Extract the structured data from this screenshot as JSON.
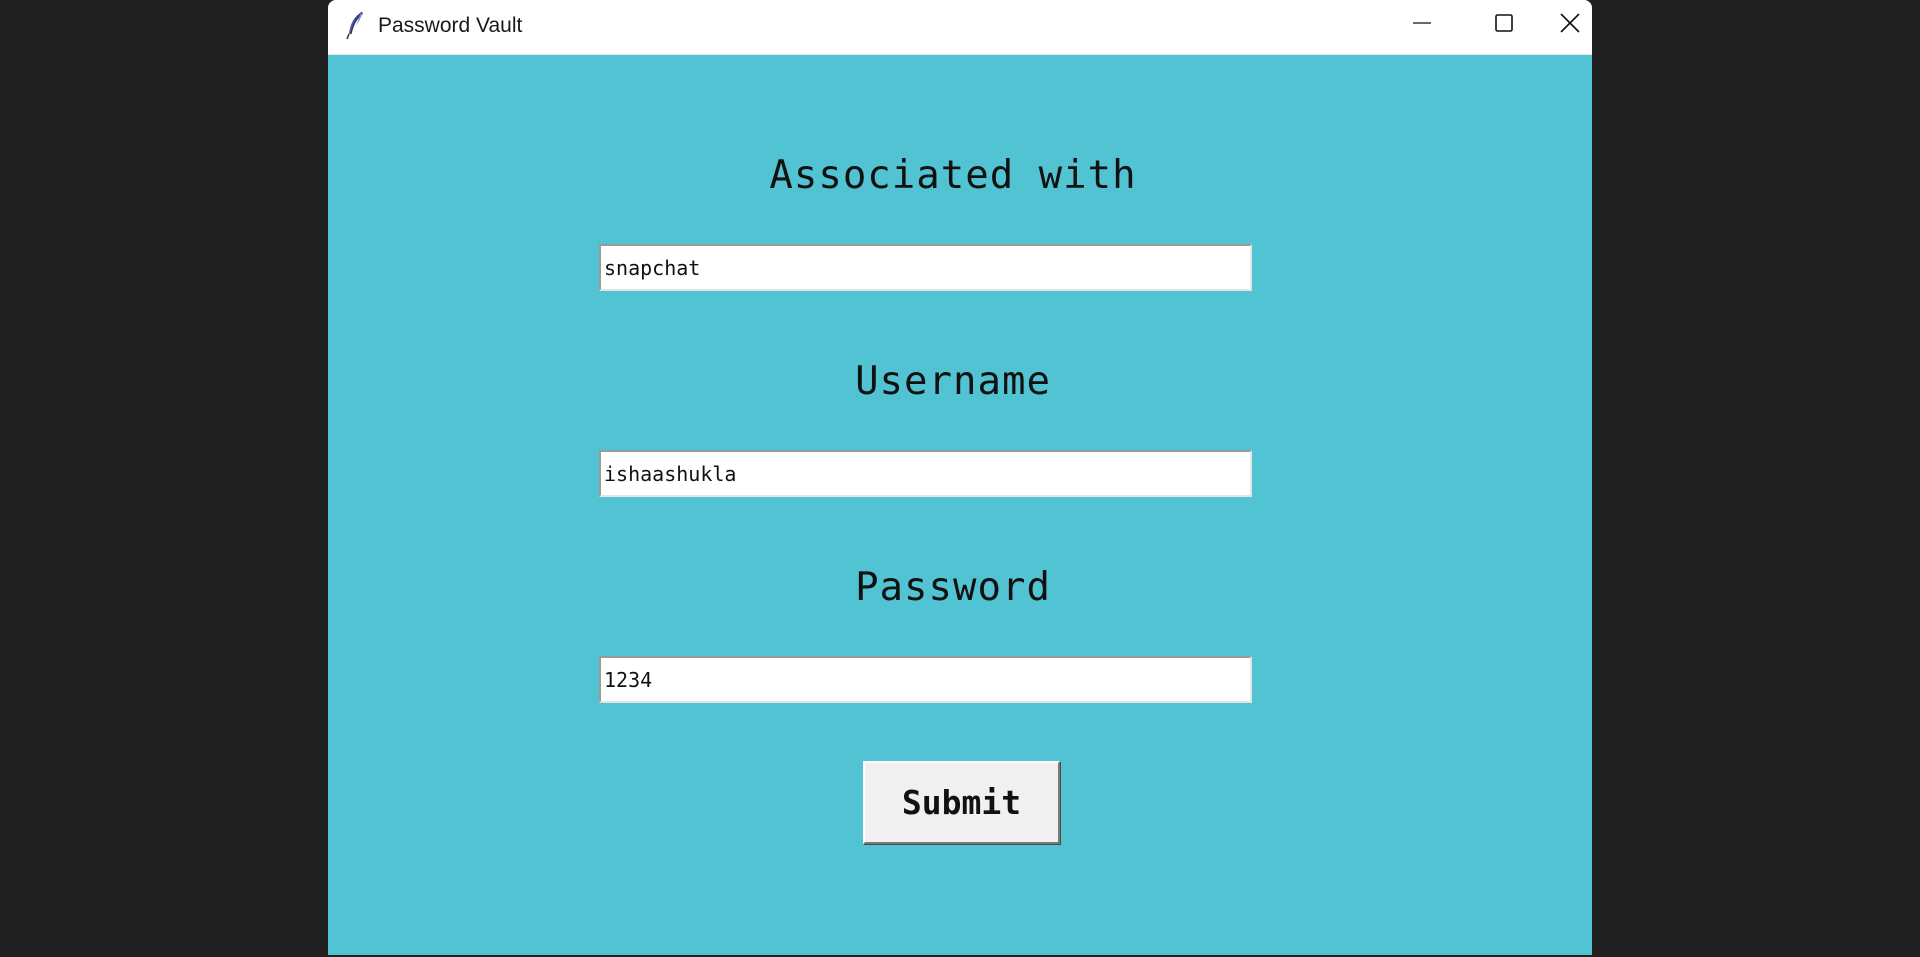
{
  "window": {
    "title": "Password Vault",
    "icon": "feather-icon",
    "controls": [
      "minimize-icon",
      "maximize-icon",
      "close-icon"
    ]
  },
  "form": {
    "associated_label": "Associated with",
    "associated_value": "snapchat",
    "username_label": "Username",
    "username_value": "ishaashukla",
    "password_label": "Password",
    "password_value": "1234",
    "submit_label": "Submit"
  },
  "colors": {
    "background": "#52c3d3",
    "desktop": "#202020",
    "titlebar": "#ffffff",
    "button": "#f0f0f0"
  }
}
